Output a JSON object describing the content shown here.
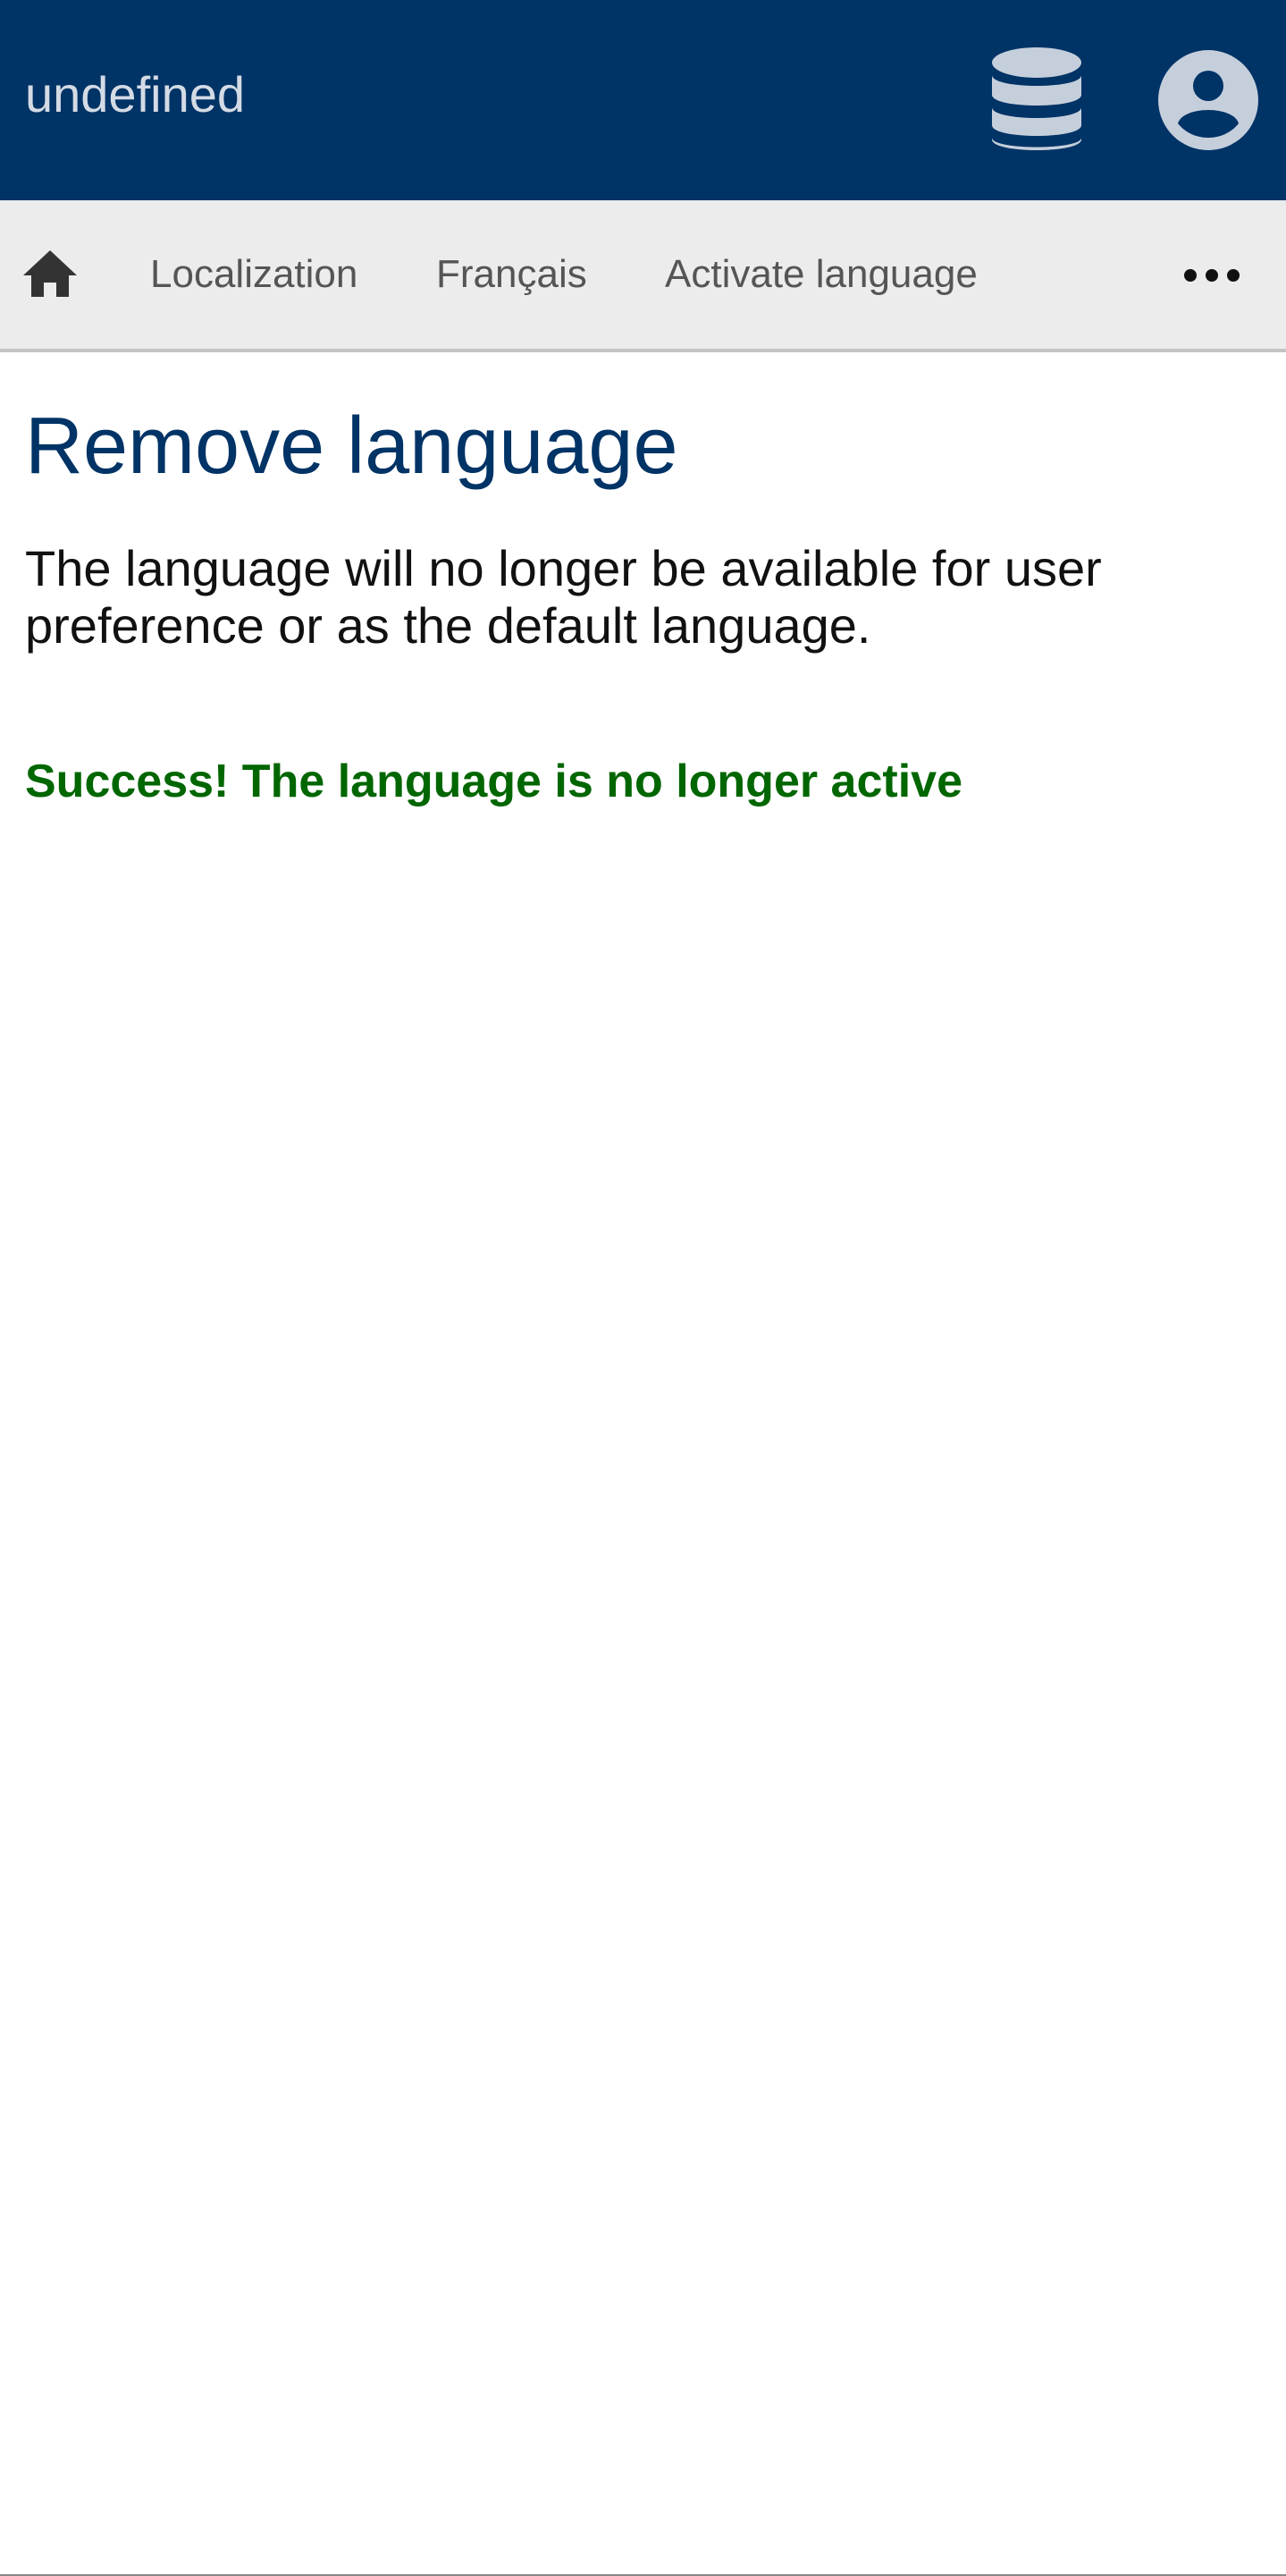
{
  "header": {
    "app_title": "undefined",
    "background_color": "#003366",
    "icons": {
      "database": "database-icon",
      "user": "user-circle-icon"
    }
  },
  "breadcrumb": {
    "home_icon": "home-icon",
    "items": [
      {
        "label": "Localization"
      },
      {
        "label": "Français"
      },
      {
        "label": "Activate language"
      }
    ],
    "more_icon": "more-horizontal-icon"
  },
  "main": {
    "title": "Remove language",
    "title_color": "#003366",
    "description": "The language will no longer be available for user preference or as the default language.",
    "success_message": "Success! The language is no longer active",
    "success_color": "#006600"
  }
}
